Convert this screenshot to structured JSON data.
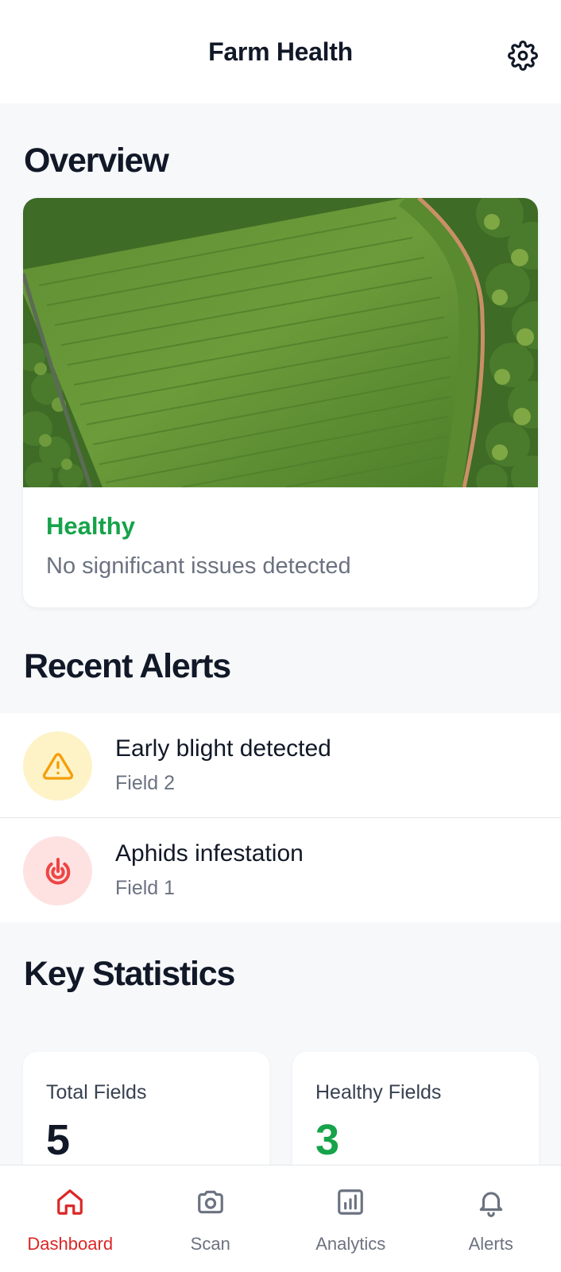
{
  "header": {
    "title": "Farm Health",
    "settings_icon": "gear-icon"
  },
  "overview": {
    "section_title": "Overview",
    "image": "aerial-field-photo",
    "status": "Healthy",
    "status_color": "#16a34a",
    "description": "No significant issues detected"
  },
  "alerts": {
    "section_title": "Recent Alerts",
    "items": [
      {
        "title": "Early blight detected",
        "field": "Field 2",
        "icon": "warning-triangle-icon",
        "icon_color": "#f59e0b",
        "bg_color": "#fef3c7"
      },
      {
        "title": "Aphids infestation",
        "field": "Field 1",
        "icon": "pest-target-icon",
        "icon_color": "#ef4444",
        "bg_color": "#fee2e2"
      }
    ]
  },
  "statistics": {
    "section_title": "Key Statistics",
    "cards": [
      {
        "label": "Total Fields",
        "value": "5",
        "color": "#111827"
      },
      {
        "label": "Healthy Fields",
        "value": "3",
        "color": "#16a34a"
      }
    ]
  },
  "nav": {
    "items": [
      {
        "label": "Dashboard",
        "icon": "home-icon",
        "active": true
      },
      {
        "label": "Scan",
        "icon": "camera-icon",
        "active": false
      },
      {
        "label": "Analytics",
        "icon": "analytics-icon",
        "active": false
      },
      {
        "label": "Alerts",
        "icon": "bell-icon",
        "active": false
      }
    ],
    "active_color": "#dc2626"
  }
}
